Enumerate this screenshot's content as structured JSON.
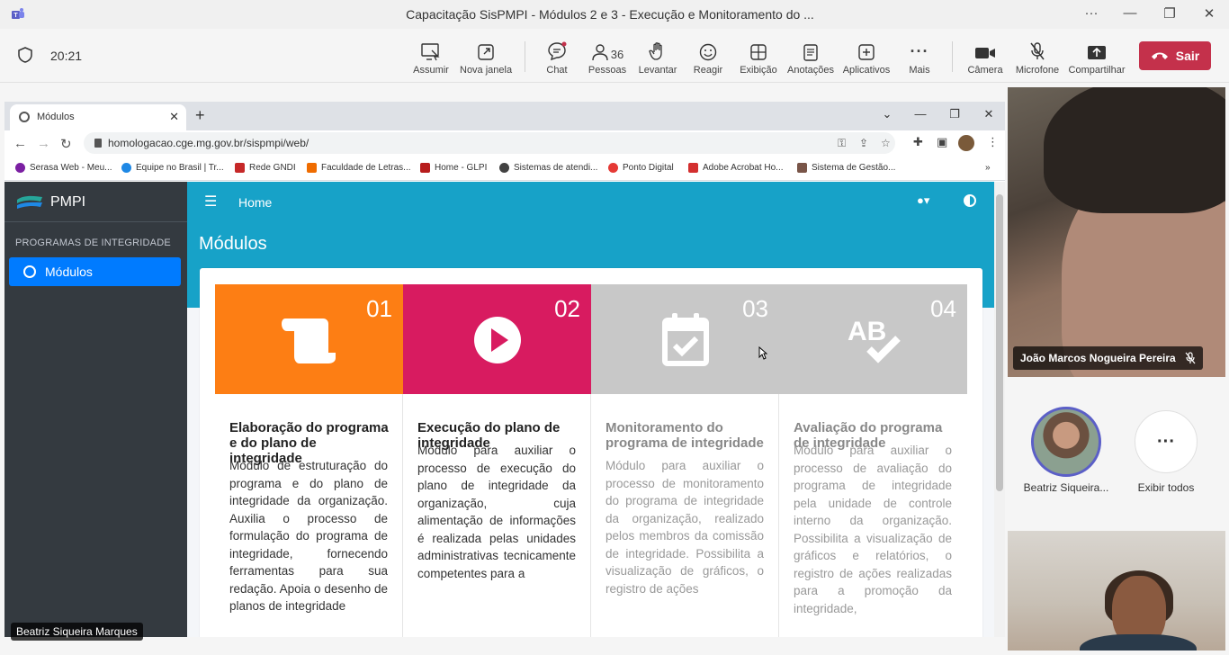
{
  "window": {
    "title": "Capacitação SisPMPI - Módulos 2 e 3 - Execução e Monitoramento do ..."
  },
  "meeting": {
    "timer": "20:21",
    "toolbar": [
      {
        "id": "assumir",
        "label": "Assumir",
        "icon": "take-control-icon"
      },
      {
        "id": "nova-janela",
        "label": "Nova janela",
        "icon": "popout-icon"
      },
      {
        "id": "chat",
        "label": "Chat",
        "icon": "chat-icon"
      },
      {
        "id": "pessoas",
        "label": "Pessoas",
        "icon": "people-icon",
        "count": "36"
      },
      {
        "id": "levantar",
        "label": "Levantar",
        "icon": "raise-hand-icon"
      },
      {
        "id": "reagir",
        "label": "Reagir",
        "icon": "smile-icon"
      },
      {
        "id": "exibicao",
        "label": "Exibição",
        "icon": "layout-icon"
      },
      {
        "id": "anotacoes",
        "label": "Anotações",
        "icon": "notes-icon"
      },
      {
        "id": "aplicativos",
        "label": "Aplicativos",
        "icon": "apps-icon"
      },
      {
        "id": "mais",
        "label": "Mais",
        "icon": "more-icon"
      },
      {
        "id": "camera",
        "label": "Câmera",
        "icon": "camera-icon"
      },
      {
        "id": "microfone",
        "label": "Microfone",
        "icon": "mic-off-icon"
      },
      {
        "id": "compartilhar",
        "label": "Compartilhar",
        "icon": "share-icon"
      }
    ],
    "leave_label": "Sair",
    "leave_color": "#c4314b",
    "presenter_name": "Beatriz Siqueira Marques",
    "participants": [
      {
        "name": "João Marcos Nogueira Pereira"
      },
      {
        "name": "Beatriz Siqueira..."
      }
    ],
    "show_all_label": "Exibir todos"
  },
  "browser": {
    "tab_title": "Módulos",
    "url": "homologacao.cge.mg.gov.br/sispmpi/web/",
    "bookmarks": [
      {
        "label": "Serasa Web - Meu...",
        "color": "#7b1fa2"
      },
      {
        "label": "Equipe no Brasil | Tr...",
        "color": "#1e88e5"
      },
      {
        "label": "Rede GNDI",
        "color": "#c62828"
      },
      {
        "label": "Faculdade de Letras...",
        "color": "#ef6c00"
      },
      {
        "label": "Home - GLPI",
        "color": "#b71c1c"
      },
      {
        "label": "Sistemas de atendi...",
        "color": "#424242"
      },
      {
        "label": "Ponto Digital",
        "color": "#e53935"
      },
      {
        "label": "Adobe Acrobat Ho...",
        "color": "#d32f2f"
      },
      {
        "label": "Sistema de Gestão...",
        "color": "#795548"
      }
    ]
  },
  "app": {
    "brand": "PMPI",
    "sidebar_header": "PROGRAMAS DE INTEGRIDADE",
    "sidebar_item": "Módulos",
    "nav_home": "Home",
    "page_title": "Módulos",
    "accent": "#17a2c8",
    "modules": [
      {
        "number": "01",
        "title": "Elaboração do programa e do plano de integridade",
        "description": "Módulo de estruturação do programa e do plano de integridade da organização. Auxilia o processo de formulação do programa de integridade, fornecendo ferramentas para sua redação. Apoia o desenho de planos de integridade",
        "color": "#fd7e14",
        "icon": "scroll-icon",
        "state": "active"
      },
      {
        "number": "02",
        "title": "Execução do plano de integridade",
        "description": "Módulo para auxiliar o processo de execução do plano de integridade da organização, cuja alimentação de informações é realizada pelas unidades administrativas tecnicamente competentes para a",
        "color": "#d81b60",
        "icon": "play-icon",
        "state": "active"
      },
      {
        "number": "03",
        "title": "Monitoramento do programa de integridade",
        "description": "Módulo para auxiliar o processo de monitoramento do programa de integridade da organização, realizado pelos membros da comissão de integridade. Possibilita a visualização de gráficos, o registro de ações",
        "color": "#c8c8c8",
        "icon": "calendar-check-icon",
        "state": "inactive"
      },
      {
        "number": "04",
        "title": "Avaliação do programa de integridade",
        "description": "Módulo para auxiliar o processo de avaliação do programa de integridade pela unidade de controle interno da organização. Possibilita a visualização de gráficos e relatórios, o registro de ações realizadas para a promoção da integridade,",
        "color": "#c8c8c8",
        "icon": "spellcheck-icon",
        "state": "inactive"
      }
    ]
  }
}
